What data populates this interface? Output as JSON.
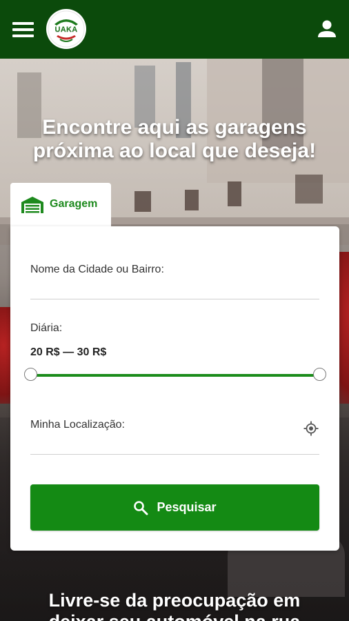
{
  "header": {
    "logo_text": "UAKA",
    "menu_icon": "hamburger-menu-icon",
    "user_icon": "user-account-icon",
    "background_color": "#0b4a0b"
  },
  "hero": {
    "headline_line1": "Encontre aqui as garagens",
    "headline_line2": "próxima ao local que deseja!"
  },
  "tabs": [
    {
      "label": "Garagem",
      "icon": "garage-icon",
      "active": true
    }
  ],
  "form": {
    "location_label": "Nome da Cidade ou Bairro:",
    "location_value": "",
    "daily_label": "Diária:",
    "daily_range_text": "20 R$ — 30 R$",
    "daily_min": 20,
    "daily_max": 30,
    "slider_selected_min_fraction": 0,
    "slider_selected_max_fraction": 1,
    "my_location_label": "Minha Localização:",
    "my_location_value": "",
    "locate_icon": "gps-crosshair-icon",
    "search_button_label": "Pesquisar",
    "search_icon": "search-icon"
  },
  "section2": {
    "headline_line1": "Livre-se da preocupação em",
    "headline_line2": "deixar seu automóvel na rua"
  },
  "colors": {
    "primary_green": "#148a14",
    "tab_text_green": "#1e8a1e",
    "dark_green": "#0b4a0b"
  }
}
